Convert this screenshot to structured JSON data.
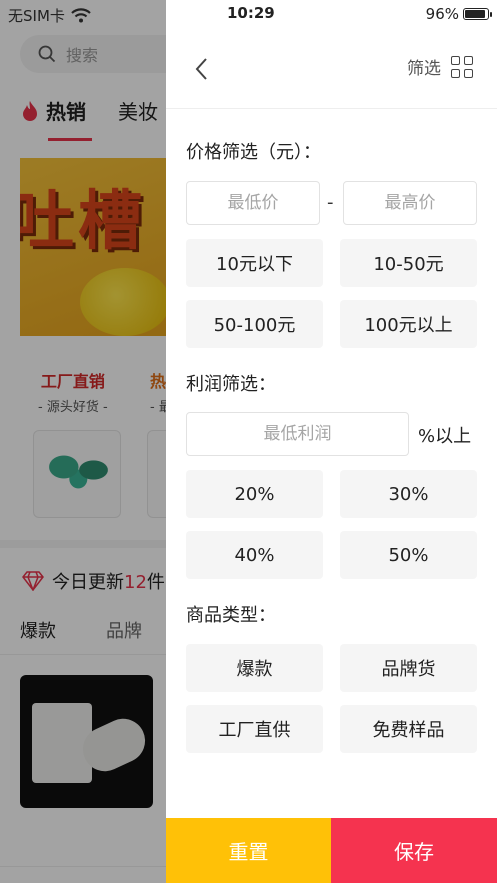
{
  "status_bar": {
    "carrier": "无SIM卡",
    "time": "10:29",
    "battery": "96%",
    "battery_level": 0.96
  },
  "background": {
    "search_placeholder": "搜索",
    "tabs": [
      {
        "label": "热销",
        "active": true
      },
      {
        "label": "美妆",
        "active": false
      }
    ],
    "banner_text": "吐槽",
    "promos": [
      {
        "title": "工厂直销",
        "subtitle": "- 源头好货 -"
      },
      {
        "title": "热",
        "subtitle": "- 最"
      }
    ],
    "update_prefix": "今日更新",
    "update_count": "12",
    "update_suffix": "件",
    "sub_tabs": [
      "爆款",
      "品牌"
    ]
  },
  "drawer": {
    "title": "筛选",
    "price": {
      "heading": "价格筛选（元）：",
      "min_placeholder": "最低价",
      "max_placeholder": "最高价",
      "separator": "-",
      "options": [
        "10元以下",
        "10-50元",
        "50-100元",
        "100元以上"
      ]
    },
    "profit": {
      "heading": "利润筛选：",
      "placeholder": "最低利润",
      "suffix": "%以上",
      "options": [
        "20%",
        "30%",
        "40%",
        "50%"
      ]
    },
    "type": {
      "heading": "商品类型：",
      "options": [
        "爆款",
        "品牌货",
        "工厂直供",
        "免费样品"
      ]
    },
    "reset_label": "重置",
    "save_label": "保存"
  },
  "colors": {
    "accent_red": "#f5334f",
    "accent_yellow": "#ffc107",
    "option_bg": "#f5f5f5"
  }
}
